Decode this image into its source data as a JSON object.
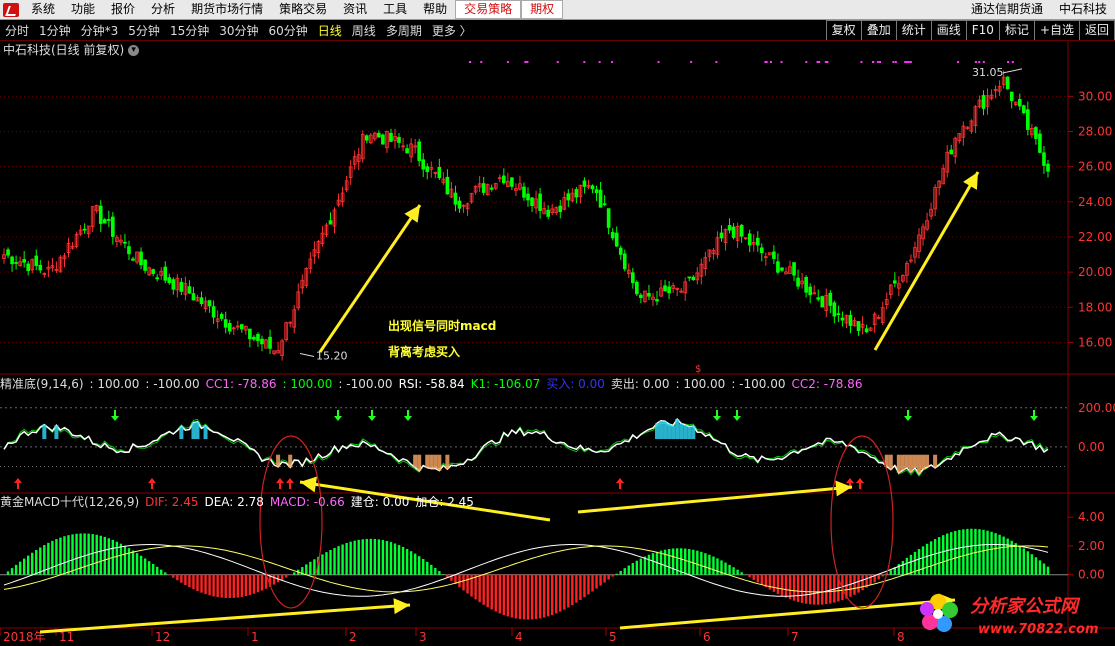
{
  "menu": {
    "items": [
      "系统",
      "功能",
      "报价",
      "分析",
      "期货市场行情",
      "策略交易",
      "资讯",
      "工具",
      "帮助",
      "交易策略",
      "期权"
    ],
    "right_items": [
      "通达信期货通",
      "中石科技"
    ]
  },
  "toolbar": {
    "periods": [
      "分时",
      "1分钟",
      "分钟*3",
      "5分钟",
      "15分钟",
      "30分钟",
      "60分钟",
      "日线",
      "周线",
      "多周期",
      "更多 〉"
    ],
    "active_period": "日线",
    "buttons": [
      "复权",
      "叠加",
      "统计",
      "画线",
      "F10",
      "标记",
      "+自选",
      "返回"
    ]
  },
  "title": "中石科技(日线 前复权)",
  "annotations": {
    "line1": "出现信号同时macd",
    "line2": "背离考虑买入",
    "high_label": "31.05",
    "low_label": "15.20"
  },
  "indicator1": {
    "name": "精准底(9,14,6)",
    "items": [
      {
        "text": ": 100.00",
        "color": "#dddddd"
      },
      {
        "text": ": -100.00",
        "color": "#dddddd"
      },
      {
        "text": "CC1: -78.86",
        "color": "#ff66ff"
      },
      {
        "text": ": 100.00",
        "color": "#00ff00"
      },
      {
        "text": ": -100.00",
        "color": "#dddddd"
      },
      {
        "text": "RSI: -58.84",
        "color": "#ffffff"
      },
      {
        "text": "K1: -106.07",
        "color": "#00ff00"
      },
      {
        "text": "买入: 0.00",
        "color": "#3333ff"
      },
      {
        "text": "卖出: 0.00",
        "color": "#dddddd"
      },
      {
        "text": ": 100.00",
        "color": "#dddddd"
      },
      {
        "text": ": -100.00",
        "color": "#dddddd"
      },
      {
        "text": "CC2: -78.86",
        "color": "#ff66ff"
      }
    ]
  },
  "indicator2": {
    "name": "黄金MACD十代(12,26,9)",
    "items": [
      {
        "text": "DIF: 2.45",
        "color": "#ff3333"
      },
      {
        "text": "DEA: 2.78",
        "color": "#ffffff"
      },
      {
        "text": "MACD: -0.66",
        "color": "#ff66ff"
      },
      {
        "text": "建仓: 0.00",
        "color": "#ffffff"
      },
      {
        "text": "加仓: 2.45",
        "color": "#ffffff"
      }
    ]
  },
  "chart_data": [
    {
      "type": "candlestick",
      "title": "中石科技(日线 前复权)",
      "y_ticks": [
        "30.00",
        "28.00",
        "26.00",
        "24.00",
        "22.00",
        "20.00",
        "18.00",
        "16.00"
      ],
      "ylim": [
        15.0,
        31.5
      ],
      "x_ticks": [
        "2018年",
        "11",
        "12",
        "1",
        "2",
        "3",
        "4",
        "5",
        "6",
        "7",
        "8"
      ],
      "annotated_high": 31.05,
      "annotated_low": 15.2,
      "approx_close_path": [
        {
          "x": "2018年",
          "y": 21.0
        },
        {
          "x": "11",
          "y": 20.0
        },
        {
          "x": "11",
          "y": 23.5
        },
        {
          "x": "12",
          "y": 20.5
        },
        {
          "x": "12",
          "y": 19.0
        },
        {
          "x": "1",
          "y": 17.0
        },
        {
          "x": "1",
          "y": 15.5
        },
        {
          "x": "2",
          "y": 22.0
        },
        {
          "x": "2",
          "y": 28.0
        },
        {
          "x": "3",
          "y": 27.0
        },
        {
          "x": "3",
          "y": 24.0
        },
        {
          "x": "4",
          "y": 25.5
        },
        {
          "x": "4",
          "y": 23.5
        },
        {
          "x": "5",
          "y": 25.0
        },
        {
          "x": "5",
          "y": 18.5
        },
        {
          "x": "6",
          "y": 19.0
        },
        {
          "x": "6",
          "y": 22.5
        },
        {
          "x": "7",
          "y": 20.5
        },
        {
          "x": "7",
          "y": 18.5
        },
        {
          "x": "7",
          "y": 16.5
        },
        {
          "x": "8",
          "y": 21.0
        },
        {
          "x": "8",
          "y": 28.0
        },
        {
          "x": "8",
          "y": 31.0
        },
        {
          "x": "8",
          "y": 26.0
        }
      ],
      "up_color": "#ff3333",
      "down_color": "#00ff00"
    },
    {
      "type": "line",
      "name": "精准底(9,14,6)",
      "y_ticks": [
        "200.00",
        "0.00"
      ],
      "ylim": [
        -200,
        250
      ]
    },
    {
      "type": "bar",
      "name": "黄金MACD十代(12,26,9)",
      "y_ticks": [
        "4.00",
        "2.00",
        "0.00"
      ],
      "ylim": [
        -3.5,
        4.5
      ],
      "dif_last": 2.45,
      "dea_last": 2.78,
      "macd_last": -0.66
    }
  ],
  "watermark": {
    "title": "分析家公式网",
    "url": "www.70822.com"
  },
  "colors": {
    "up": "#ff3333",
    "down": "#00ff00",
    "arrow_annotation": "#ffff33",
    "background": "#000000"
  }
}
